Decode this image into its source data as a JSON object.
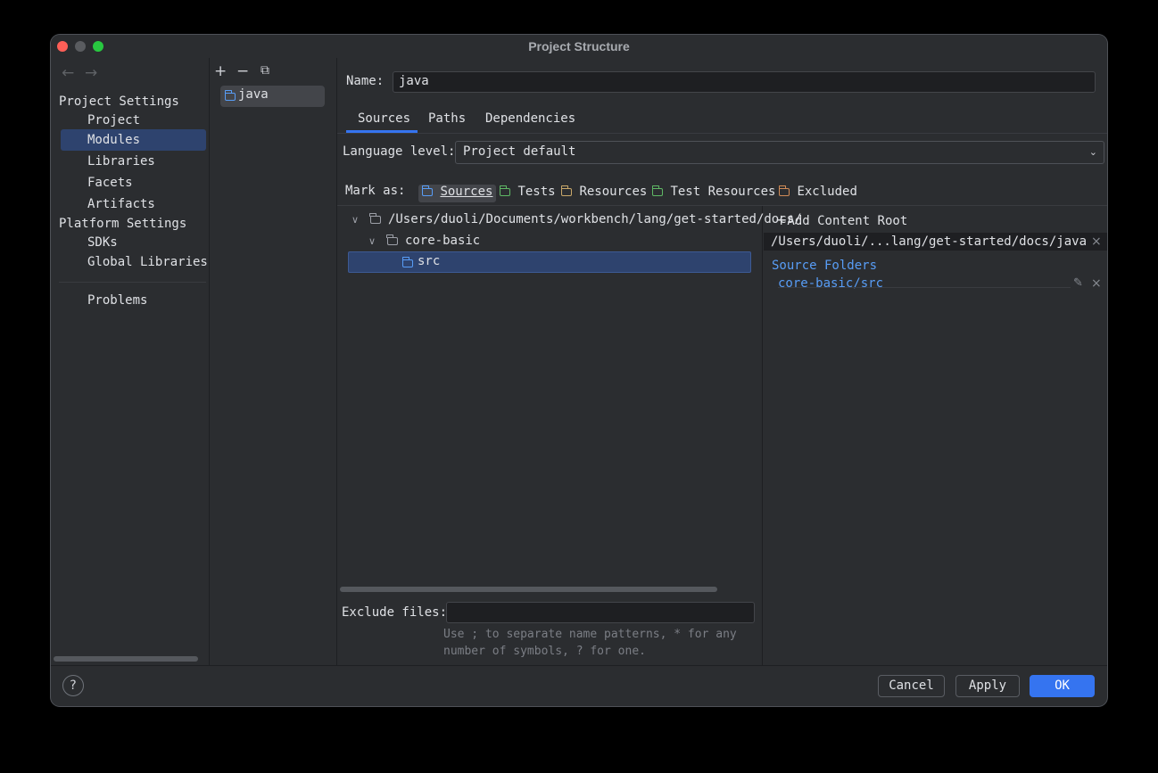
{
  "window": {
    "title": "Project Structure"
  },
  "nav": {
    "back_icon": "←",
    "forward_icon": "→",
    "project_settings": "Project Settings",
    "project_items": [
      "Project",
      "Modules",
      "Libraries",
      "Facets",
      "Artifacts"
    ],
    "platform_settings": "Platform Settings",
    "platform_items": [
      "SDKs",
      "Global Libraries"
    ],
    "problems": "Problems",
    "selected": "Modules"
  },
  "modules_toolbar": {
    "add": "+",
    "remove": "−",
    "copy": "⧉"
  },
  "modules": [
    "java"
  ],
  "name": {
    "label": "Name:",
    "value": "java"
  },
  "tabs": [
    "Sources",
    "Paths",
    "Dependencies"
  ],
  "active_tab": "Sources",
  "language_level": {
    "label": "Language level:",
    "value": "Project default"
  },
  "mark_as": {
    "label": "Mark as:",
    "options": [
      {
        "label": "Sources",
        "color": "#589df6"
      },
      {
        "label": "Tests",
        "color": "#5fb865"
      },
      {
        "label": "Resources",
        "color": "#c9a86a"
      },
      {
        "label": "Test Resources",
        "color": "#5fb865"
      },
      {
        "label": "Excluded",
        "color": "#d08b57"
      }
    ]
  },
  "tree": {
    "root": "/Users/duoli/Documents/workbench/lang/get-started/docs/",
    "child": "core-basic",
    "leaf": "src"
  },
  "exclude_files": {
    "label": "Exclude files:",
    "value": "",
    "hint_line1": "Use ; to separate name patterns, * for any",
    "hint_line2": "number of symbols, ? for one."
  },
  "content_root": {
    "add_label": "Add Content Root",
    "path": "/Users/duoli/...lang/get-started/docs/java",
    "source_folders_title": "Source Folders",
    "source_folder": "core-basic/src"
  },
  "buttons": {
    "help": "?",
    "cancel": "Cancel",
    "apply": "Apply",
    "ok": "OK"
  },
  "colors": {
    "accent": "#3574f0",
    "selection": "#2e436e",
    "link": "#589df6"
  }
}
